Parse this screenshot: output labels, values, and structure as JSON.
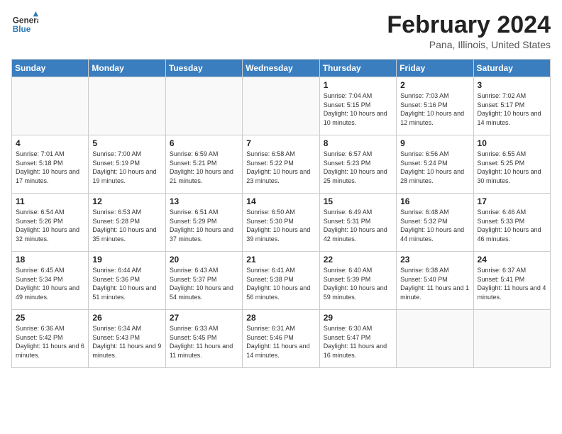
{
  "header": {
    "logo_line1": "General",
    "logo_line2": "Blue",
    "month": "February 2024",
    "location": "Pana, Illinois, United States"
  },
  "weekdays": [
    "Sunday",
    "Monday",
    "Tuesday",
    "Wednesday",
    "Thursday",
    "Friday",
    "Saturday"
  ],
  "weeks": [
    [
      {
        "day": "",
        "sunrise": "",
        "sunset": "",
        "daylight": ""
      },
      {
        "day": "",
        "sunrise": "",
        "sunset": "",
        "daylight": ""
      },
      {
        "day": "",
        "sunrise": "",
        "sunset": "",
        "daylight": ""
      },
      {
        "day": "",
        "sunrise": "",
        "sunset": "",
        "daylight": ""
      },
      {
        "day": "1",
        "sunrise": "Sunrise: 7:04 AM",
        "sunset": "Sunset: 5:15 PM",
        "daylight": "Daylight: 10 hours and 10 minutes."
      },
      {
        "day": "2",
        "sunrise": "Sunrise: 7:03 AM",
        "sunset": "Sunset: 5:16 PM",
        "daylight": "Daylight: 10 hours and 12 minutes."
      },
      {
        "day": "3",
        "sunrise": "Sunrise: 7:02 AM",
        "sunset": "Sunset: 5:17 PM",
        "daylight": "Daylight: 10 hours and 14 minutes."
      }
    ],
    [
      {
        "day": "4",
        "sunrise": "Sunrise: 7:01 AM",
        "sunset": "Sunset: 5:18 PM",
        "daylight": "Daylight: 10 hours and 17 minutes."
      },
      {
        "day": "5",
        "sunrise": "Sunrise: 7:00 AM",
        "sunset": "Sunset: 5:19 PM",
        "daylight": "Daylight: 10 hours and 19 minutes."
      },
      {
        "day": "6",
        "sunrise": "Sunrise: 6:59 AM",
        "sunset": "Sunset: 5:21 PM",
        "daylight": "Daylight: 10 hours and 21 minutes."
      },
      {
        "day": "7",
        "sunrise": "Sunrise: 6:58 AM",
        "sunset": "Sunset: 5:22 PM",
        "daylight": "Daylight: 10 hours and 23 minutes."
      },
      {
        "day": "8",
        "sunrise": "Sunrise: 6:57 AM",
        "sunset": "Sunset: 5:23 PM",
        "daylight": "Daylight: 10 hours and 25 minutes."
      },
      {
        "day": "9",
        "sunrise": "Sunrise: 6:56 AM",
        "sunset": "Sunset: 5:24 PM",
        "daylight": "Daylight: 10 hours and 28 minutes."
      },
      {
        "day": "10",
        "sunrise": "Sunrise: 6:55 AM",
        "sunset": "Sunset: 5:25 PM",
        "daylight": "Daylight: 10 hours and 30 minutes."
      }
    ],
    [
      {
        "day": "11",
        "sunrise": "Sunrise: 6:54 AM",
        "sunset": "Sunset: 5:26 PM",
        "daylight": "Daylight: 10 hours and 32 minutes."
      },
      {
        "day": "12",
        "sunrise": "Sunrise: 6:53 AM",
        "sunset": "Sunset: 5:28 PM",
        "daylight": "Daylight: 10 hours and 35 minutes."
      },
      {
        "day": "13",
        "sunrise": "Sunrise: 6:51 AM",
        "sunset": "Sunset: 5:29 PM",
        "daylight": "Daylight: 10 hours and 37 minutes."
      },
      {
        "day": "14",
        "sunrise": "Sunrise: 6:50 AM",
        "sunset": "Sunset: 5:30 PM",
        "daylight": "Daylight: 10 hours and 39 minutes."
      },
      {
        "day": "15",
        "sunrise": "Sunrise: 6:49 AM",
        "sunset": "Sunset: 5:31 PM",
        "daylight": "Daylight: 10 hours and 42 minutes."
      },
      {
        "day": "16",
        "sunrise": "Sunrise: 6:48 AM",
        "sunset": "Sunset: 5:32 PM",
        "daylight": "Daylight: 10 hours and 44 minutes."
      },
      {
        "day": "17",
        "sunrise": "Sunrise: 6:46 AM",
        "sunset": "Sunset: 5:33 PM",
        "daylight": "Daylight: 10 hours and 46 minutes."
      }
    ],
    [
      {
        "day": "18",
        "sunrise": "Sunrise: 6:45 AM",
        "sunset": "Sunset: 5:34 PM",
        "daylight": "Daylight: 10 hours and 49 minutes."
      },
      {
        "day": "19",
        "sunrise": "Sunrise: 6:44 AM",
        "sunset": "Sunset: 5:36 PM",
        "daylight": "Daylight: 10 hours and 51 minutes."
      },
      {
        "day": "20",
        "sunrise": "Sunrise: 6:43 AM",
        "sunset": "Sunset: 5:37 PM",
        "daylight": "Daylight: 10 hours and 54 minutes."
      },
      {
        "day": "21",
        "sunrise": "Sunrise: 6:41 AM",
        "sunset": "Sunset: 5:38 PM",
        "daylight": "Daylight: 10 hours and 56 minutes."
      },
      {
        "day": "22",
        "sunrise": "Sunrise: 6:40 AM",
        "sunset": "Sunset: 5:39 PM",
        "daylight": "Daylight: 10 hours and 59 minutes."
      },
      {
        "day": "23",
        "sunrise": "Sunrise: 6:38 AM",
        "sunset": "Sunset: 5:40 PM",
        "daylight": "Daylight: 11 hours and 1 minute."
      },
      {
        "day": "24",
        "sunrise": "Sunrise: 6:37 AM",
        "sunset": "Sunset: 5:41 PM",
        "daylight": "Daylight: 11 hours and 4 minutes."
      }
    ],
    [
      {
        "day": "25",
        "sunrise": "Sunrise: 6:36 AM",
        "sunset": "Sunset: 5:42 PM",
        "daylight": "Daylight: 11 hours and 6 minutes."
      },
      {
        "day": "26",
        "sunrise": "Sunrise: 6:34 AM",
        "sunset": "Sunset: 5:43 PM",
        "daylight": "Daylight: 11 hours and 9 minutes."
      },
      {
        "day": "27",
        "sunrise": "Sunrise: 6:33 AM",
        "sunset": "Sunset: 5:45 PM",
        "daylight": "Daylight: 11 hours and 11 minutes."
      },
      {
        "day": "28",
        "sunrise": "Sunrise: 6:31 AM",
        "sunset": "Sunset: 5:46 PM",
        "daylight": "Daylight: 11 hours and 14 minutes."
      },
      {
        "day": "29",
        "sunrise": "Sunrise: 6:30 AM",
        "sunset": "Sunset: 5:47 PM",
        "daylight": "Daylight: 11 hours and 16 minutes."
      },
      {
        "day": "",
        "sunrise": "",
        "sunset": "",
        "daylight": ""
      },
      {
        "day": "",
        "sunrise": "",
        "sunset": "",
        "daylight": ""
      }
    ]
  ]
}
